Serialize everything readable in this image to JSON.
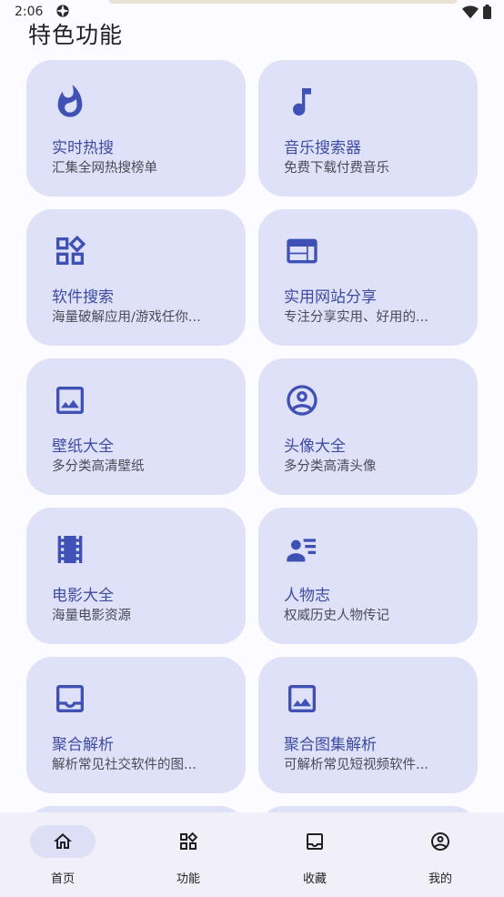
{
  "status": {
    "time": "2:06"
  },
  "section_title": "特色功能",
  "accent": "#3f51b5",
  "cards": [
    {
      "title": "实时热搜",
      "subtitle": "汇集全网热搜榜单",
      "icon": "fire-icon"
    },
    {
      "title": "音乐搜索器",
      "subtitle": "免费下载付费音乐",
      "icon": "music-note-icon"
    },
    {
      "title": "软件搜索",
      "subtitle": "海量破解应用/游戏任你...",
      "icon": "apps-icon"
    },
    {
      "title": "实用网站分享",
      "subtitle": "专注分享实用、好用的...",
      "icon": "web-icon"
    },
    {
      "title": "壁纸大全",
      "subtitle": "多分类高清壁纸",
      "icon": "image-icon"
    },
    {
      "title": "头像大全",
      "subtitle": "多分类高清头像",
      "icon": "avatar-icon"
    },
    {
      "title": "电影大全",
      "subtitle": "海量电影资源",
      "icon": "film-icon"
    },
    {
      "title": "人物志",
      "subtitle": "权威历史人物传记",
      "icon": "person-list-icon"
    },
    {
      "title": "聚合解析",
      "subtitle": "解析常见社交软件的图...",
      "icon": "inbox-icon"
    },
    {
      "title": "聚合图集解析",
      "subtitle": "可解析常见短视频软件...",
      "icon": "image-icon"
    }
  ],
  "nav": [
    {
      "label": "首页",
      "icon": "home-icon",
      "active": true
    },
    {
      "label": "功能",
      "icon": "apps-icon",
      "active": false
    },
    {
      "label": "收藏",
      "icon": "inbox-icon",
      "active": false
    },
    {
      "label": "我的",
      "icon": "avatar-icon",
      "active": false
    }
  ]
}
